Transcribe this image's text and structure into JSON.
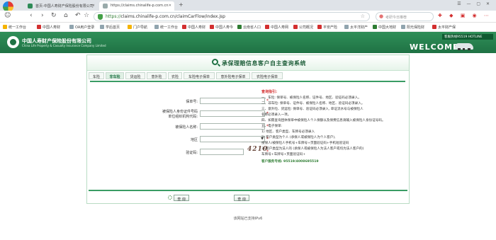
{
  "browser": {
    "tabs": [
      {
        "label": "首页-中国人寿财产保险股份有限公司"
      },
      {
        "label": "https://claims.chinalife-p.com.cn"
      }
    ],
    "url_scheme": "https://",
    "url_rest": "claims.chinalife-p.com.cn/claimCarFlow/index.jsp",
    "search_placeholder": "考研今日推荐",
    "bookmarks": [
      "收藏",
      "手机收藏夹",
      "统一工作台",
      "中国人寿财",
      "OA用户登录",
      "学后首页",
      "门户导航",
      "统一工作台",
      "中国人寿财",
      "中国人寿今",
      "云南省人口",
      "中国人寿网",
      "公司概况",
      "平安产险",
      "太平洋财产",
      "中国大地财",
      "阳光保险财",
      "太平财产保"
    ]
  },
  "header": {
    "company_cn": "中国人寿财产保险股份有限公司",
    "company_en": "China Life Property & Casualty Insurance Company Limited",
    "service_phone": "客服热线95519  HOTLINE",
    "welcome": "WELCOME"
  },
  "panel": {
    "title": "承保理赔信息客户自主查询系统",
    "tabs": [
      "车险",
      "非车险",
      "货运险",
      "意外险",
      "农险",
      "车险电子保单",
      "意外险电子保单",
      "农险电子保单"
    ],
    "active_tab_index": 1
  },
  "form": {
    "policy_no_label": "保单号:",
    "id_label_line1": "被保险人身份证件号码",
    "id_label_line2": "单位组织机构代码:",
    "name_label": "被保险人名称:",
    "region_label": "地区",
    "captcha_label": "验证码:",
    "captcha_value": "4210",
    "required_mark": "*",
    "region_value": ""
  },
  "notes": {
    "title": "查询指引:",
    "lines": [
      "一、车险: 保单号、被保险人名称、证件号、地区、验证码必须录入。",
      "二、非车险: 保单号、证件号、被保险人名称、地区、验证码必须录入。",
      "三、意外险、货运险: 保单号、验证码必须录入, 单证流水号与被保险人",
      "      名称必须录入一项。",
      "四、如需查询团体保单中被保险人个人保额以及保费信息请输入被保险人身份证号码。",
      "五、电子保单:",
      "   1) 地区、客户类型、车牌号必须录入",
      "   2) 客户类型为个人 (承保人或被保险人为个人客户),",
      "      投保人/被保险人手机号+车牌号+页面验证码+手机短验证码",
      "   3) 客户类型为法人的 (承保人或被保险人为法人客户或均为法人客户的)",
      "      车牌号+车牌号+页面验证码+"
    ],
    "hotline": "客户服务专线: 95519/4008695519"
  },
  "buttons": {
    "submit": "查 询",
    "reset": "查 询"
  },
  "footer": "该网站已支持IPv6",
  "colors": {
    "brand_green": "#1f7244",
    "required_red": "#d32f2f"
  }
}
